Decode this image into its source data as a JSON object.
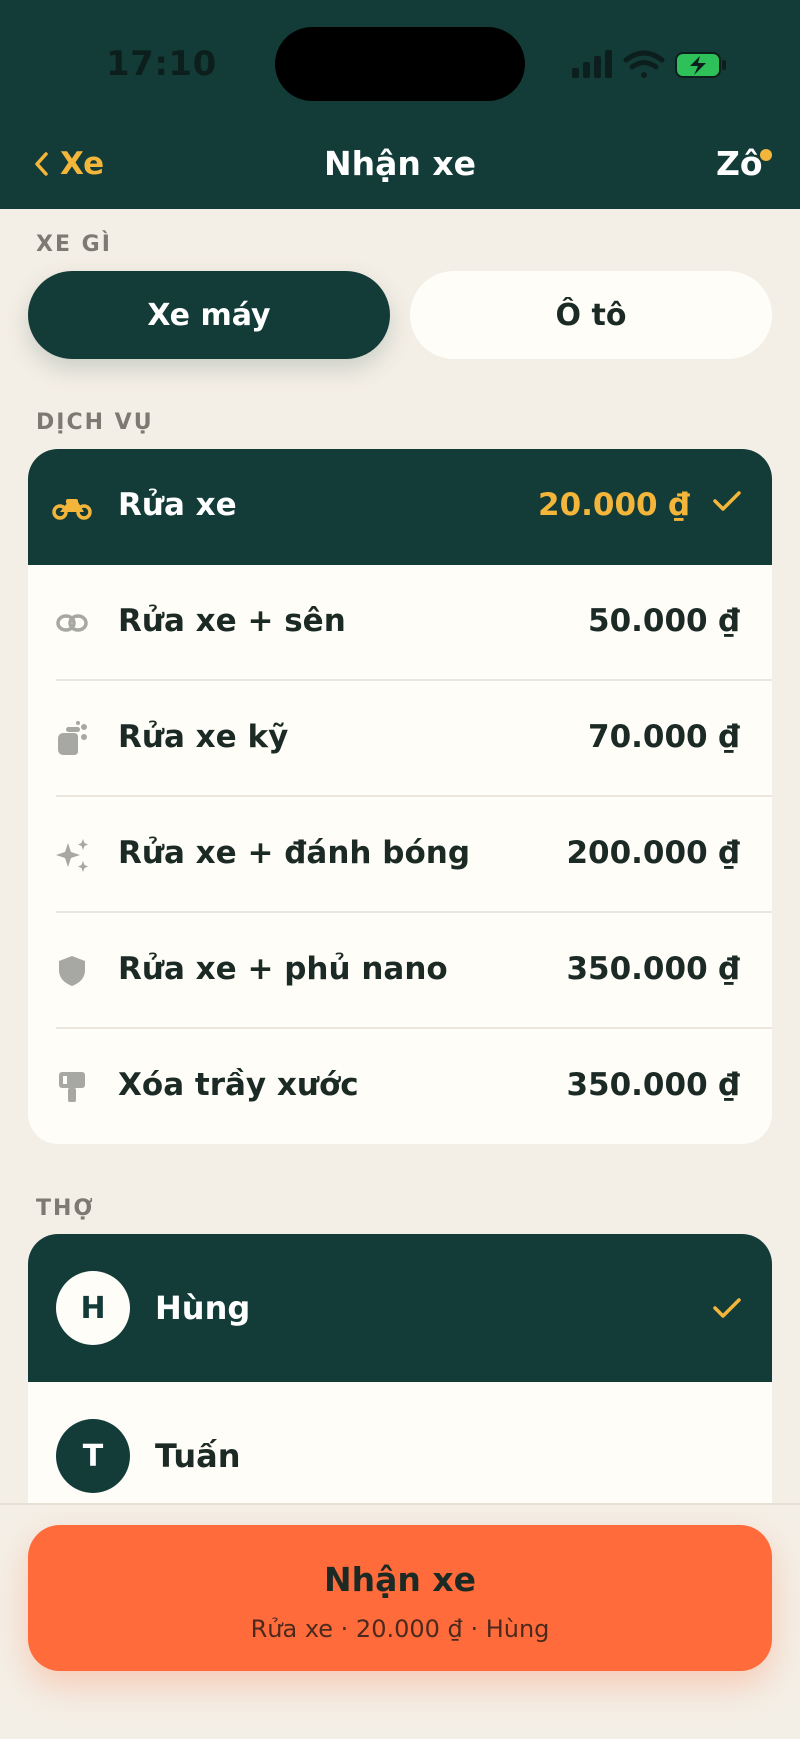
{
  "status_bar": {
    "time": "17:10"
  },
  "nav": {
    "back_label": "Xe",
    "title": "Nhận xe",
    "user_label": "Zô"
  },
  "vehicle_section": {
    "label": "XE GÌ",
    "options": [
      {
        "label": "Xe máy",
        "selected": true
      },
      {
        "label": "Ô tô",
        "selected": false
      }
    ]
  },
  "services_section": {
    "label": "DỊCH VỤ",
    "items": [
      {
        "name": "Rửa xe",
        "price": "20.000 ₫",
        "icon": "motorbike-icon",
        "selected": true
      },
      {
        "name": "Rửa xe + sên",
        "price": "50.000 ₫",
        "icon": "chain-icon",
        "selected": false
      },
      {
        "name": "Rửa xe kỹ",
        "price": "70.000 ₫",
        "icon": "scrub-hand-icon",
        "selected": false
      },
      {
        "name": "Rửa xe + đánh bóng",
        "price": "200.000 ₫",
        "icon": "sparkles-icon",
        "selected": false
      },
      {
        "name": "Rửa xe + phủ nano",
        "price": "350.000 ₫",
        "icon": "shield-icon",
        "selected": false
      },
      {
        "name": "Xóa trầy xước",
        "price": "350.000 ₫",
        "icon": "paint-roller-icon",
        "selected": false
      }
    ]
  },
  "workers_section": {
    "label": "THỢ",
    "items": [
      {
        "initial": "H",
        "name": "Hùng",
        "selected": true
      },
      {
        "initial": "T",
        "name": "Tuấn",
        "selected": false
      }
    ]
  },
  "cta": {
    "title": "Nhận xe",
    "subtitle": "Rửa xe · 20.000 ₫ · Hùng"
  },
  "colors": {
    "primary": "#133c39",
    "accent": "#f3b63a",
    "cta": "#ff6b3a",
    "background": "#f4efe6",
    "card": "#fefdf8"
  }
}
